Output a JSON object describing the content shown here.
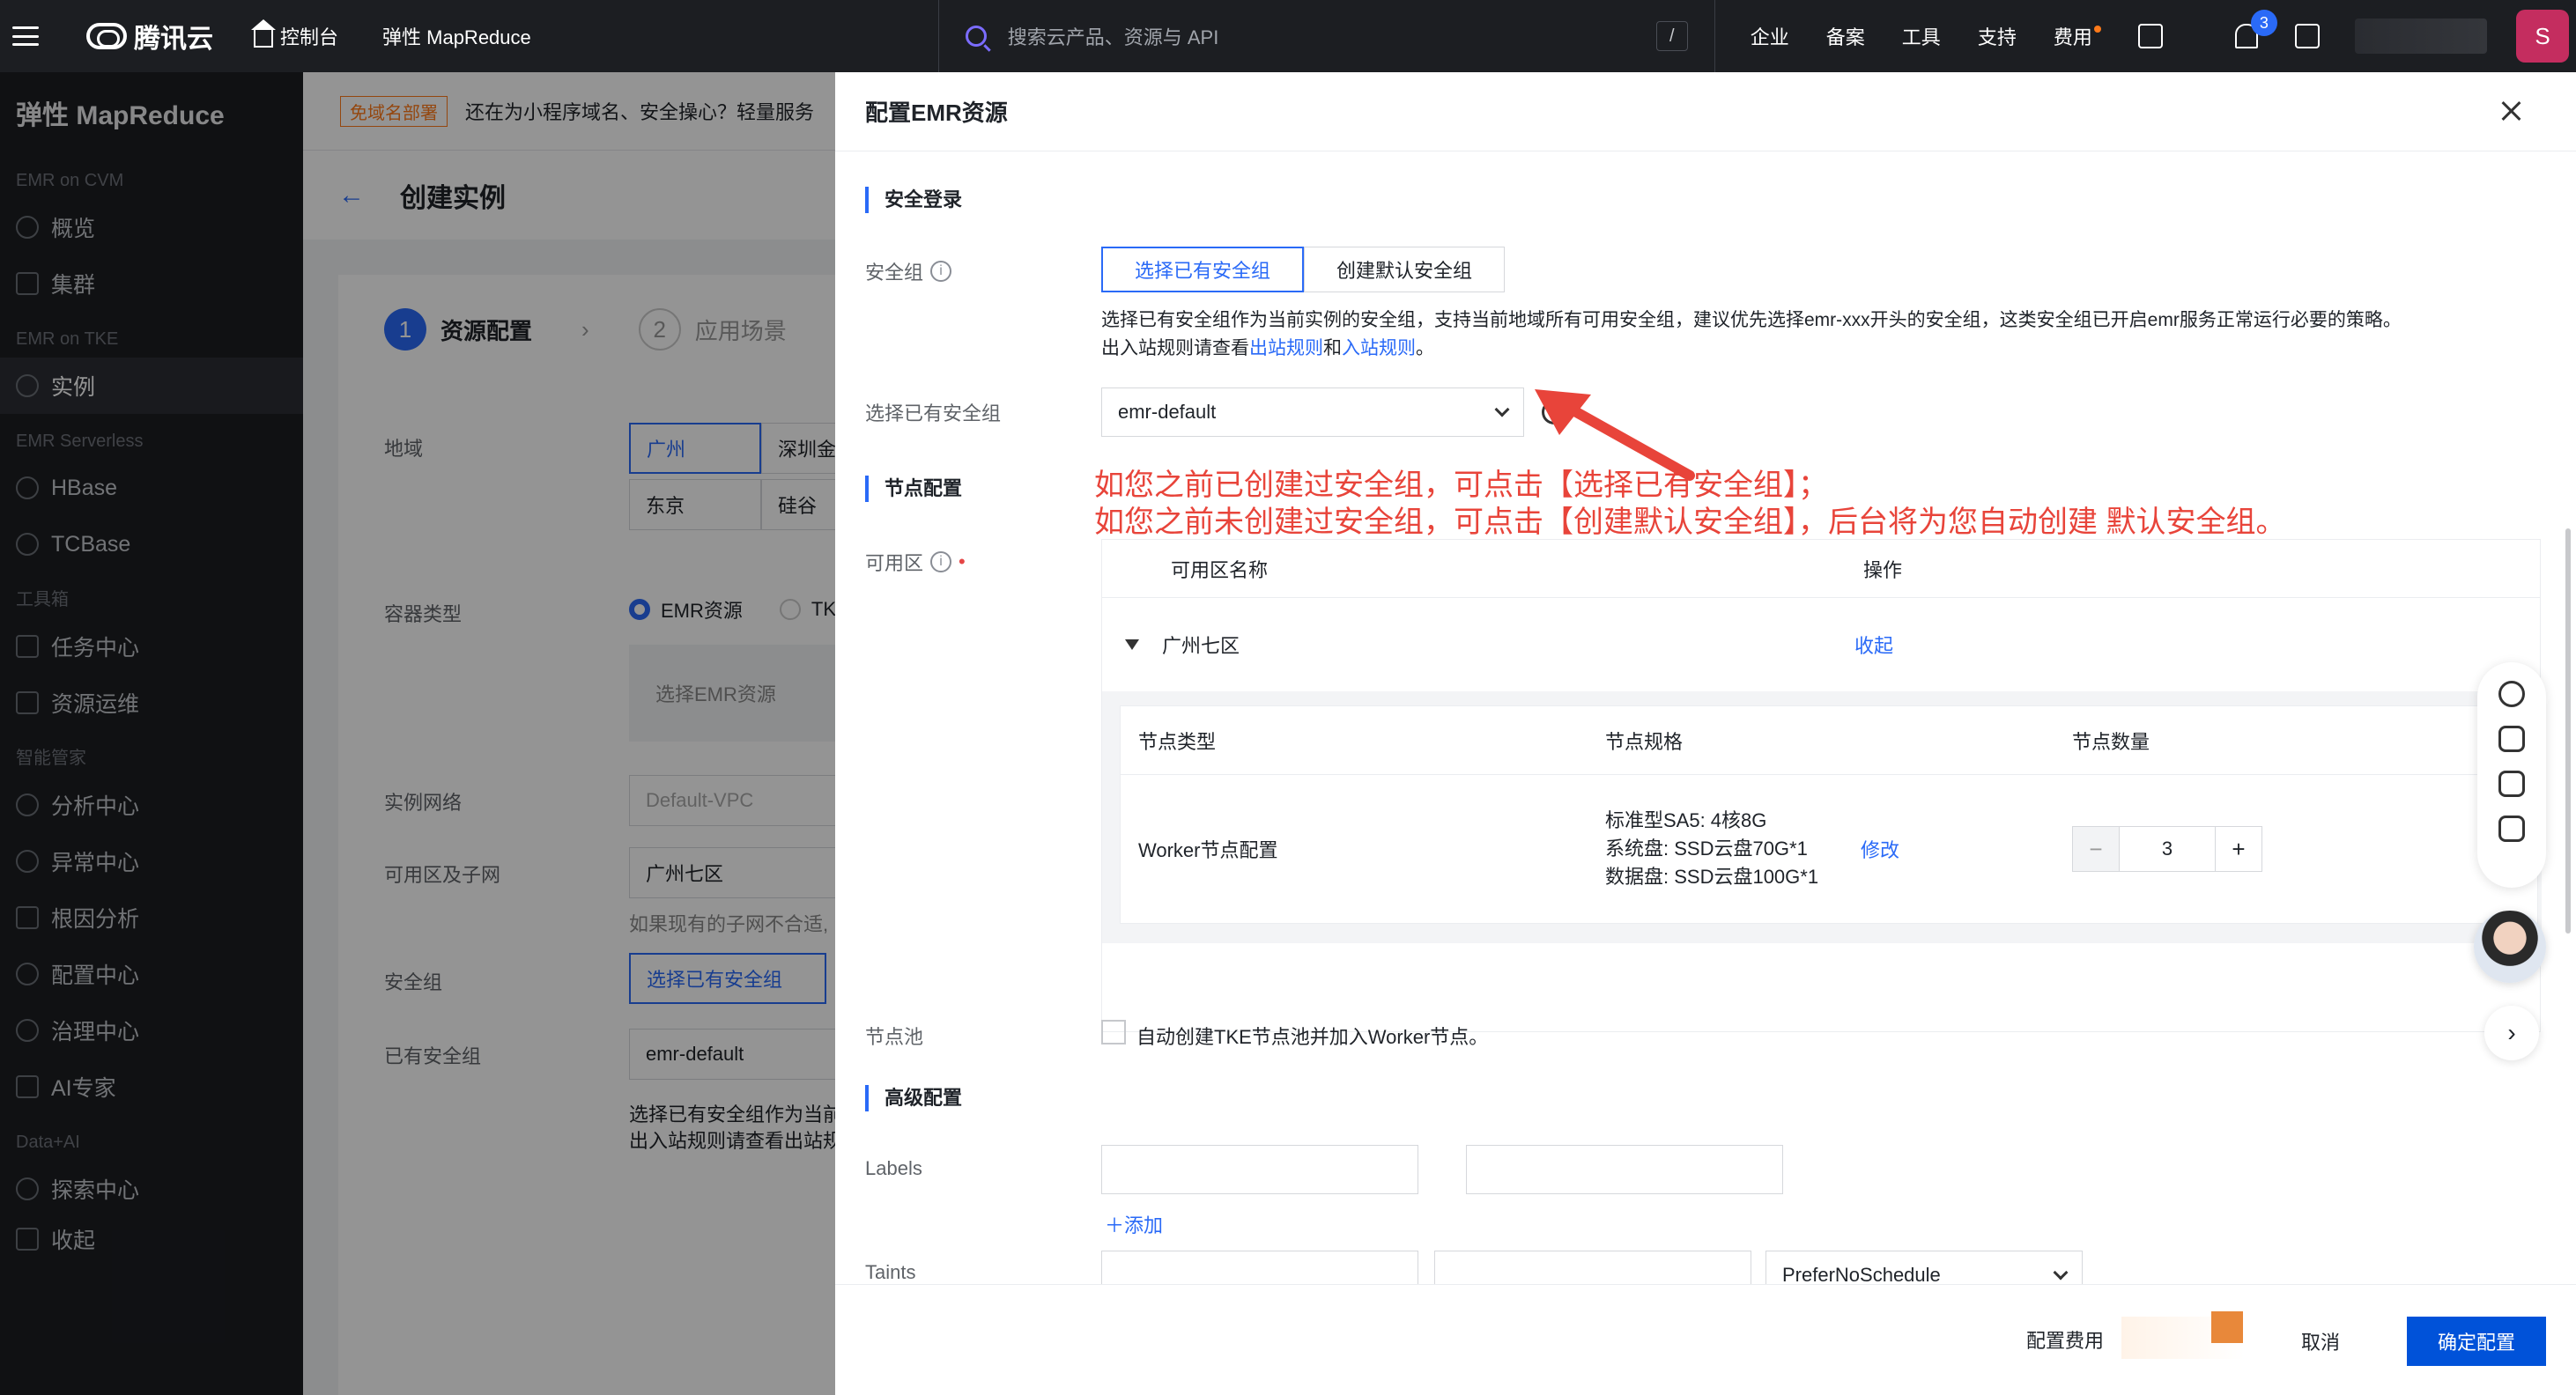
{
  "topbar": {
    "brand": "腾讯云",
    "console": "控制台",
    "product": "弹性 MapReduce",
    "search_placeholder": "搜索云产品、资源与 API",
    "slash": "/",
    "nav": [
      "企业",
      "备案",
      "工具",
      "支持",
      "费用"
    ],
    "notification_count": "3",
    "avatar_letter": "S"
  },
  "sidebar": {
    "title": "弹性 MapReduce",
    "groups": [
      {
        "label": "EMR on CVM",
        "items": [
          "概览",
          "集群"
        ]
      },
      {
        "label": "EMR on TKE",
        "items": [
          "实例"
        ]
      },
      {
        "label": "EMR Serverless",
        "items": [
          "HBase",
          "TCBase"
        ]
      },
      {
        "label": "工具箱",
        "items": [
          "任务中心",
          "资源运维"
        ]
      },
      {
        "label": "智能管家",
        "items": [
          "分析中心",
          "异常中心",
          "根因分析",
          "配置中心",
          "治理中心",
          "AI专家"
        ]
      },
      {
        "label": "Data+AI",
        "items": [
          "探索中心",
          "收起"
        ]
      }
    ],
    "active": "实例"
  },
  "background": {
    "notice_tag": "免域名部署",
    "notice_text": "还在为小程序域名、安全操心？轻量服务",
    "page_title": "创建实例",
    "step1": "资源配置",
    "step2": "应用场景",
    "labels": {
      "region": "地域",
      "container": "容器类型",
      "network": "实例网络",
      "subnet": "可用区及子网",
      "sg": "安全组",
      "existing_sg": "已有安全组"
    },
    "regions": [
      "广州",
      "深圳金融",
      "东京",
      "硅谷"
    ],
    "container_emr": "EMR资源",
    "container_tke": "TKE",
    "select_emr": "选择EMR资源",
    "network_value": "Default-VPC",
    "subnet_value": "广州七区",
    "subnet_hint": "如果现有的子网不合适,",
    "sg_button": "选择已有安全组",
    "sg_value": "emr-default",
    "sg_desc1": "选择已有安全组作为当前",
    "sg_desc2": "出入站规则请查看出站规"
  },
  "drawer": {
    "title": "配置EMR资源",
    "security_section": "安全登录",
    "sg_label": "安全组",
    "seg_existing": "选择已有安全组",
    "seg_default": "创建默认安全组",
    "desc_line1": "选择已有安全组作为当前实例的安全组，支持当前地域所有可用安全组，建议优先选择emr-xxx开头的安全组，这类安全组已开启emr服务正常运行必要的策略。",
    "desc_line2_prefix": "出入站规则请查看",
    "desc_outbound": "出站规则",
    "desc_and": "和",
    "desc_inbound": "入站规则",
    "desc_end": "。",
    "existing_sg_label": "选择已有安全组",
    "existing_sg_value": "emr-default",
    "annotation_line1": "如您之前已创建过安全组，可点击【选择已有安全组】；",
    "annotation_line2": "如您之前未创建过安全组，可点击【创建默认安全组】，后台将为您自动创建 默认安全组。",
    "node_section": "节点配置",
    "zone_label": "可用区",
    "zone_col_name": "可用区名称",
    "zone_col_action": "操作",
    "zone_name": "广州七区",
    "zone_action": "收起",
    "node_type_col": "节点类型",
    "node_spec_col": "节点规格",
    "node_count_col": "节点数量",
    "node_type": "Worker节点配置",
    "spec_line1": "标准型SA5: 4核8G",
    "spec_line2": "系统盘: SSD云盘70G*1",
    "spec_line3": "数据盘: SSD云盘100G*1",
    "modify": "修改",
    "node_count": "3",
    "pool_label": "节点池",
    "pool_checkbox": "自动创建TKE节点池并加入Worker节点。",
    "advanced_section": "高级配置",
    "labels_label": "Labels",
    "add_link": "＋添加",
    "taints_label": "Taints",
    "taint_effect": "PreferNoSchedule",
    "fee_label": "配置费用",
    "cancel": "取消",
    "confirm": "确定配置"
  },
  "colors": {
    "accent": "#2a6af7",
    "annotation": "#e8443a",
    "primary_button": "#0052d9"
  }
}
